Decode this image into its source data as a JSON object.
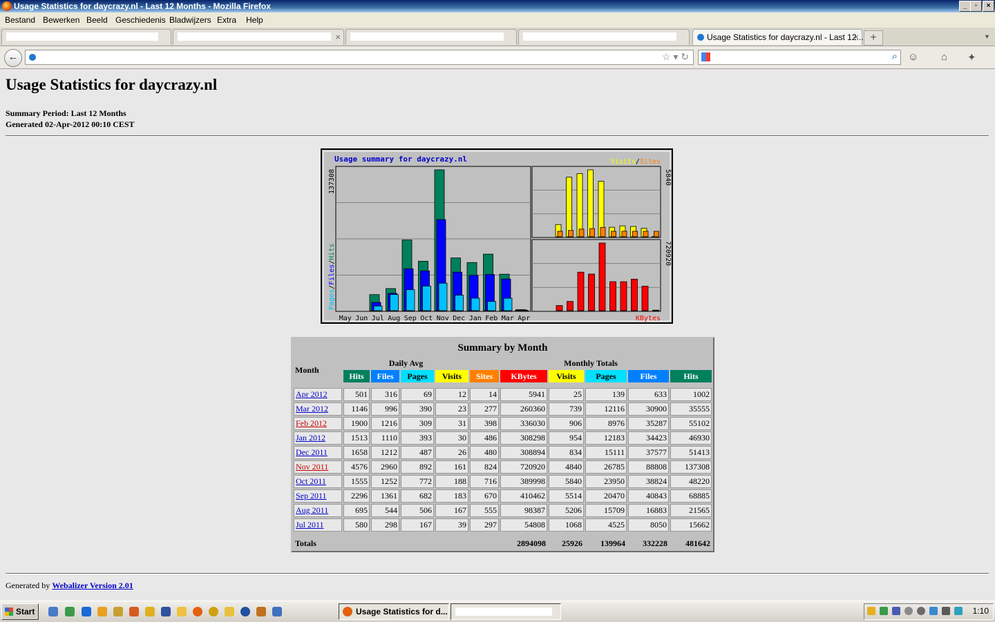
{
  "window": {
    "title": "Usage Statistics for daycrazy.nl - Last 12 Months - Mozilla Firefox"
  },
  "menu": [
    "Bestand",
    "Bewerken",
    "Beeld",
    "Geschiedenis",
    "Bladwijzers",
    "Extra",
    "Help"
  ],
  "tabs": {
    "active_label": "Usage Statistics for daycrazy.nl - Last 12..."
  },
  "page": {
    "heading": "Usage Statistics for daycrazy.nl",
    "summary_period": "Summary Period: Last 12 Months",
    "generated": "Generated 02-Apr-2012 00:10 CEST",
    "footer_prefix": "Generated by ",
    "footer_link": "Webalizer Version 2.01"
  },
  "chart_data": {
    "type": "bar",
    "title": "Usage summary for daycrazy.nl",
    "categories": [
      "May",
      "Jun",
      "Jul",
      "Aug",
      "Sep",
      "Oct",
      "Nov",
      "Dec",
      "Jan",
      "Feb",
      "Mar",
      "Apr"
    ],
    "left_panel": {
      "ylabel_max": "137308",
      "legend": [
        "Pages",
        "/",
        "Files",
        "/",
        "Hits"
      ],
      "series": [
        {
          "name": "Hits",
          "color": "#00805c",
          "values": [
            0,
            0,
            15662,
            21565,
            68885,
            48220,
            137308,
            51413,
            46930,
            55102,
            35555,
            1002
          ]
        },
        {
          "name": "Files",
          "color": "#0000ff",
          "values": [
            0,
            0,
            8050,
            16883,
            40843,
            38824,
            88808,
            37577,
            34423,
            35287,
            30900,
            633
          ]
        },
        {
          "name": "Pages",
          "color": "#00c0ff",
          "values": [
            0,
            0,
            4525,
            15709,
            20470,
            23950,
            26785,
            15111,
            12183,
            8976,
            12116,
            139
          ]
        }
      ]
    },
    "visits_panel": {
      "ylabel_max": "5840",
      "legend": [
        "Visits",
        "/",
        "Sites"
      ],
      "series": [
        {
          "name": "Visits",
          "color": "#ffff00",
          "values": [
            0,
            0,
            1068,
            5206,
            5514,
            5840,
            4840,
            834,
            954,
            906,
            739,
            25
          ]
        },
        {
          "name": "Sites",
          "color": "#ff8000",
          "values": [
            0,
            0,
            297,
            555,
            670,
            716,
            824,
            480,
            486,
            398,
            277,
            14
          ]
        }
      ]
    },
    "kbytes_panel": {
      "ylabel_max": "720920",
      "legend": [
        "KBytes"
      ],
      "series": [
        {
          "name": "KBytes",
          "color": "#ff0000",
          "values": [
            0,
            0,
            54808,
            98387,
            410462,
            389998,
            720920,
            308894,
            308298,
            336030,
            260360,
            5941
          ]
        }
      ]
    }
  },
  "table": {
    "title": "Summary by Month",
    "month_header": "Month",
    "daily_avg_header": "Daily Avg",
    "monthly_totals_header": "Monthly Totals",
    "daily_cols": [
      {
        "label": "Hits",
        "color": "#00805c",
        "fg": "#ffffff"
      },
      {
        "label": "Files",
        "color": "#0080ff",
        "fg": "#ffffff"
      },
      {
        "label": "Pages",
        "color": "#00e0ff",
        "fg": "#000000"
      },
      {
        "label": "Visits",
        "color": "#ffff00",
        "fg": "#000000"
      }
    ],
    "monthly_cols": [
      {
        "label": "Sites",
        "color": "#ff8000",
        "fg": "#ffffff"
      },
      {
        "label": "KBytes",
        "color": "#ff0000",
        "fg": "#ffffff"
      },
      {
        "label": "Visits",
        "color": "#ffff00",
        "fg": "#000000"
      },
      {
        "label": "Pages",
        "color": "#00e0ff",
        "fg": "#000000"
      },
      {
        "label": "Files",
        "color": "#0080ff",
        "fg": "#ffffff"
      },
      {
        "label": "Hits",
        "color": "#00805c",
        "fg": "#ffffff"
      }
    ],
    "rows": [
      {
        "month": "Apr 2012",
        "max": false,
        "cells": [
          "501",
          "316",
          "69",
          "12",
          "14",
          "5941",
          "25",
          "139",
          "633",
          "1002"
        ]
      },
      {
        "month": "Mar 2012",
        "max": false,
        "cells": [
          "1146",
          "996",
          "390",
          "23",
          "277",
          "260360",
          "739",
          "12116",
          "30900",
          "35555"
        ]
      },
      {
        "month": "Feb 2012",
        "max": true,
        "cells": [
          "1900",
          "1216",
          "309",
          "31",
          "398",
          "336030",
          "906",
          "8976",
          "35287",
          "55102"
        ]
      },
      {
        "month": "Jan 2012",
        "max": false,
        "cells": [
          "1513",
          "1110",
          "393",
          "30",
          "486",
          "308298",
          "954",
          "12183",
          "34423",
          "46930"
        ]
      },
      {
        "month": "Dec 2011",
        "max": false,
        "cells": [
          "1658",
          "1212",
          "487",
          "26",
          "480",
          "308894",
          "834",
          "15111",
          "37577",
          "51413"
        ]
      },
      {
        "month": "Nov 2011",
        "max": true,
        "cells": [
          "4576",
          "2960",
          "892",
          "161",
          "824",
          "720920",
          "4840",
          "26785",
          "88808",
          "137308"
        ]
      },
      {
        "month": "Oct 2011",
        "max": false,
        "cells": [
          "1555",
          "1252",
          "772",
          "188",
          "716",
          "389998",
          "5840",
          "23950",
          "38824",
          "48220"
        ]
      },
      {
        "month": "Sep 2011",
        "max": false,
        "cells": [
          "2296",
          "1361",
          "682",
          "183",
          "670",
          "410462",
          "5514",
          "20470",
          "40843",
          "68885"
        ]
      },
      {
        "month": "Aug 2011",
        "max": false,
        "cells": [
          "695",
          "544",
          "506",
          "167",
          "555",
          "98387",
          "5206",
          "15709",
          "16883",
          "21565"
        ]
      },
      {
        "month": "Jul 2011",
        "max": false,
        "cells": [
          "580",
          "298",
          "167",
          "39",
          "297",
          "54808",
          "1068",
          "4525",
          "8050",
          "15662"
        ]
      }
    ],
    "totals": {
      "label": "Totals",
      "cells": [
        "2894098",
        "25926",
        "139964",
        "332228",
        "481642"
      ]
    }
  },
  "taskbar": {
    "start_label": "Start",
    "active_task": "Usage Statistics for d...",
    "clock": "1:10"
  }
}
